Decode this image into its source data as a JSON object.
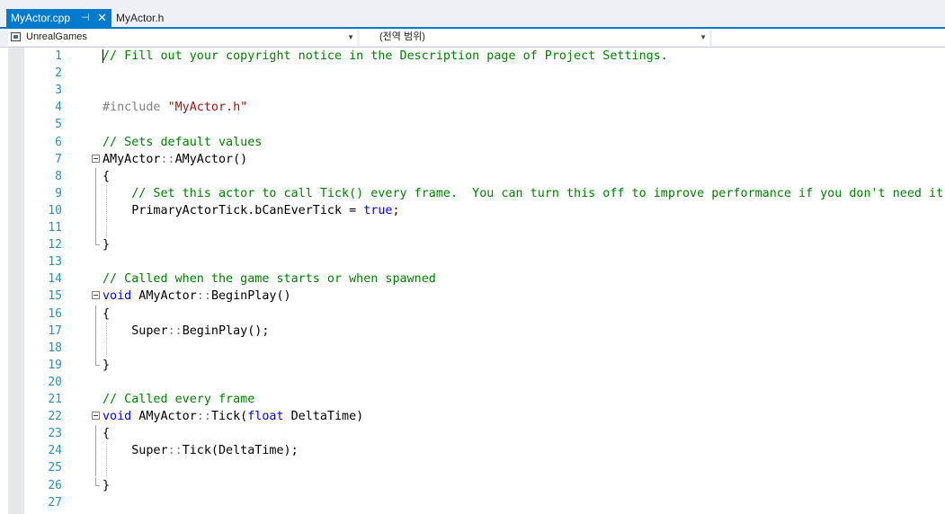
{
  "tabs": {
    "active": {
      "label": "MyActor.cpp",
      "pin_icon": "pin-icon",
      "close_icon": "close-icon"
    },
    "inactive": {
      "label": "MyActor.h"
    }
  },
  "navbar": {
    "project": {
      "icon": "project-icon",
      "label": "UnrealGames"
    },
    "scope": {
      "label": "(전역 범위)"
    },
    "member": {
      "label": ""
    }
  },
  "colors": {
    "accent": "#007acc",
    "comment": "#008000",
    "keyword": "#0000ff",
    "string": "#a31515",
    "preprocessor": "#808080",
    "line_number": "#2b91af"
  },
  "editor": {
    "lines": [
      {
        "n": "1",
        "fold": "",
        "tokens": [
          [
            "comment",
            "// Fill out your copyright notice in the Description page of Project Settings."
          ]
        ]
      },
      {
        "n": "2",
        "fold": "",
        "tokens": []
      },
      {
        "n": "3",
        "fold": "",
        "tokens": []
      },
      {
        "n": "4",
        "fold": "",
        "tokens": [
          [
            "pre",
            "#include "
          ],
          [
            "string",
            "\"MyActor.h\""
          ]
        ]
      },
      {
        "n": "5",
        "fold": "",
        "tokens": []
      },
      {
        "n": "6",
        "fold": "",
        "tokens": [
          [
            "comment",
            "// Sets default values"
          ]
        ]
      },
      {
        "n": "7",
        "fold": "box",
        "tokens": [
          [
            "plain",
            "AMyActor"
          ],
          [
            "scope",
            "::"
          ],
          [
            "plain",
            "AMyActor()"
          ]
        ]
      },
      {
        "n": "8",
        "fold": "line",
        "tokens": [
          [
            "plain",
            "{"
          ]
        ]
      },
      {
        "n": "9",
        "fold": "line",
        "indent": true,
        "tokens": [
          [
            "plain",
            "    "
          ],
          [
            "comment",
            "// Set this actor to call Tick() every frame.  You can turn this off to improve performance if you don't need it."
          ]
        ]
      },
      {
        "n": "10",
        "fold": "line",
        "indent": true,
        "tokens": [
          [
            "plain",
            "    PrimaryActorTick.bCanEverTick = "
          ],
          [
            "keyword",
            "true"
          ],
          [
            "plain",
            ";"
          ]
        ]
      },
      {
        "n": "11",
        "fold": "line",
        "indent": true,
        "tokens": []
      },
      {
        "n": "12",
        "fold": "end",
        "tokens": [
          [
            "plain",
            "}"
          ]
        ]
      },
      {
        "n": "13",
        "fold": "",
        "tokens": []
      },
      {
        "n": "14",
        "fold": "",
        "tokens": [
          [
            "comment",
            "// Called when the game starts or when spawned"
          ]
        ]
      },
      {
        "n": "15",
        "fold": "box",
        "tokens": [
          [
            "keyword",
            "void"
          ],
          [
            "plain",
            " AMyActor"
          ],
          [
            "scope",
            "::"
          ],
          [
            "plain",
            "BeginPlay()"
          ]
        ]
      },
      {
        "n": "16",
        "fold": "line",
        "tokens": [
          [
            "plain",
            "{"
          ]
        ]
      },
      {
        "n": "17",
        "fold": "line",
        "indent": true,
        "tokens": [
          [
            "plain",
            "    Super"
          ],
          [
            "scope",
            "::"
          ],
          [
            "plain",
            "BeginPlay();"
          ]
        ]
      },
      {
        "n": "18",
        "fold": "line",
        "indent": true,
        "tokens": []
      },
      {
        "n": "19",
        "fold": "end",
        "tokens": [
          [
            "plain",
            "}"
          ]
        ]
      },
      {
        "n": "20",
        "fold": "",
        "tokens": []
      },
      {
        "n": "21",
        "fold": "",
        "tokens": [
          [
            "comment",
            "// Called every frame"
          ]
        ]
      },
      {
        "n": "22",
        "fold": "box",
        "tokens": [
          [
            "keyword",
            "void"
          ],
          [
            "plain",
            " AMyActor"
          ],
          [
            "scope",
            "::"
          ],
          [
            "plain",
            "Tick("
          ],
          [
            "keyword",
            "float"
          ],
          [
            "plain",
            " DeltaTime)"
          ]
        ]
      },
      {
        "n": "23",
        "fold": "line",
        "tokens": [
          [
            "plain",
            "{"
          ]
        ]
      },
      {
        "n": "24",
        "fold": "line",
        "indent": true,
        "tokens": [
          [
            "plain",
            "    Super"
          ],
          [
            "scope",
            "::"
          ],
          [
            "plain",
            "Tick(DeltaTime);"
          ]
        ]
      },
      {
        "n": "25",
        "fold": "line",
        "indent": true,
        "tokens": []
      },
      {
        "n": "26",
        "fold": "end",
        "tokens": [
          [
            "plain",
            "}"
          ]
        ]
      },
      {
        "n": "27",
        "fold": "",
        "tokens": []
      }
    ]
  }
}
